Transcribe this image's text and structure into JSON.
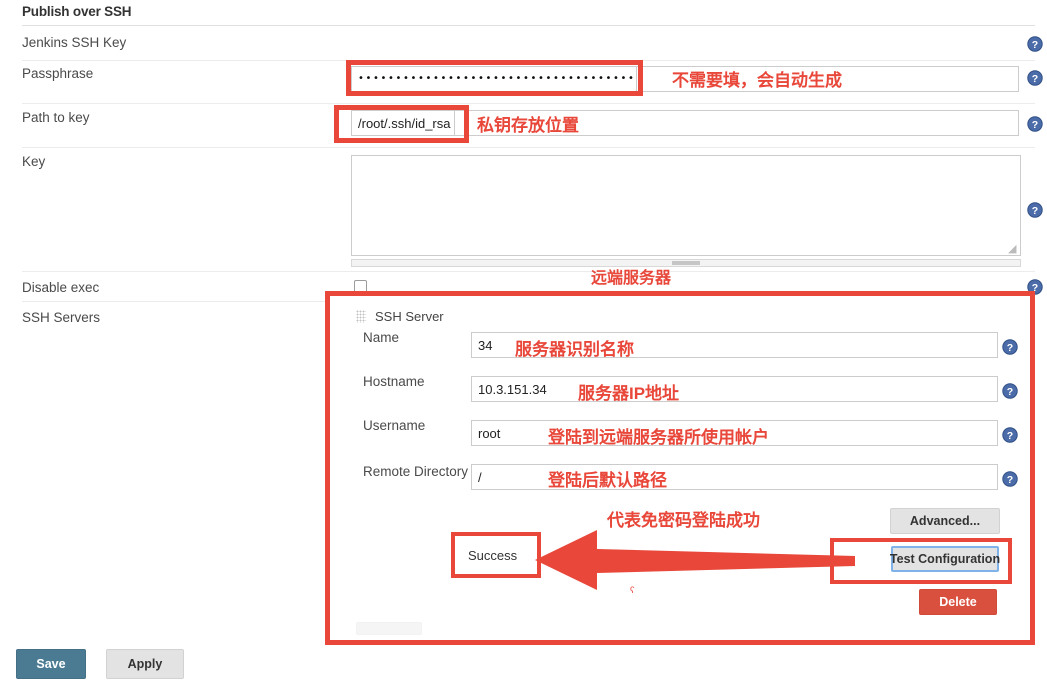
{
  "section": {
    "title": "Publish over SSH"
  },
  "fields": {
    "jenkins_ssh_key_label": "Jenkins SSH Key",
    "passphrase_label": "Passphrase",
    "passphrase_value": "••••••••••••••••••••••••••••••••••••••••••••••••••••••••••",
    "path_to_key_label": "Path to key",
    "path_to_key_value": "/root/.ssh/id_rsa",
    "key_label": "Key",
    "key_value": "",
    "disable_exec_label": "Disable exec",
    "disable_exec_checked": false,
    "ssh_servers_label": "SSH Servers"
  },
  "ssh_server": {
    "title": "SSH Server",
    "name_label": "Name",
    "name_value": "34",
    "hostname_label": "Hostname",
    "hostname_value": "10.3.151.34",
    "username_label": "Username",
    "username_value": "root",
    "remote_dir_label": "Remote Directory",
    "remote_dir_value": "/",
    "advanced_label": "Advanced...",
    "test_config_label": "Test Configuration",
    "delete_label": "Delete",
    "test_result": "Success"
  },
  "form_actions": {
    "save_label": "Save",
    "apply_label": "Apply"
  },
  "annotations": {
    "passphrase_note": "不需要填，会自动生成",
    "path_note": "私钥存放位置",
    "remote_server_note": "远端服务器",
    "name_note": "服务器识别名称",
    "hostname_note": "服务器IP地址",
    "username_note": "登陆到远端服务器所使用帐户",
    "remote_dir_note": "登陆后默认路径",
    "success_note": "代表免密码登陆成功"
  },
  "colors": {
    "annotation_red": "#e8473a",
    "save_blue": "#4b7b93",
    "delete_red": "#d9503f",
    "help_blue": "#3c5f9e",
    "focus_blue": "#7fb2e8"
  },
  "icons": {
    "help": "help-circle-icon",
    "grip": "drag-grip-icon",
    "resize": "resize-handle-icon",
    "arrow": "left-arrow-annotation"
  }
}
